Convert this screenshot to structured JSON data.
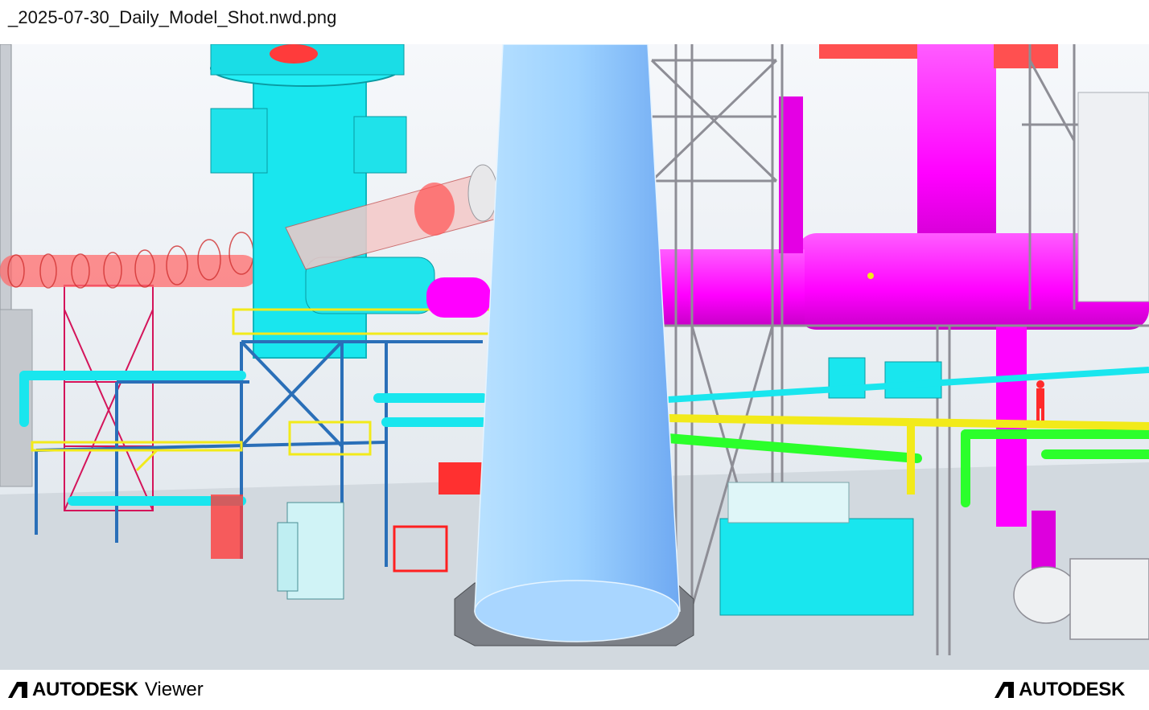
{
  "window": {
    "file_title": "_2025-07-30_Daily_Model_Shot.nwd.png"
  },
  "viewport": {
    "scene": "3D industrial plant model (piping, structural steel, vessels)",
    "colors": {
      "background": "#eef2f6",
      "cyan_equipment": "#19e6ee",
      "magenta_pipe": "#ff00ff",
      "red_duct": "#ff4a4a",
      "steel_frame": "#8e8e96",
      "blue_column": "#9dd2ff",
      "green_pipe": "#2bff2b",
      "yellow_rail": "#f2ea1a",
      "structural_blue": "#2a6fb8"
    }
  },
  "footer": {
    "left_brand": "AUTODESK",
    "left_product": "Viewer",
    "right_brand": "AUTODESK"
  }
}
